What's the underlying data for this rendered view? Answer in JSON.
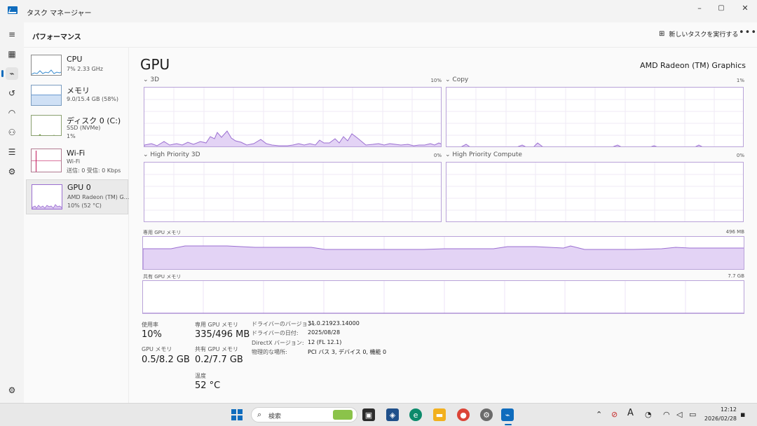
{
  "window": {
    "title": "タスク マネージャー",
    "controls": {
      "minimize": "–",
      "maximize": "▢",
      "close": "✕"
    }
  },
  "header": {
    "title": "パフォーマンス",
    "new_task_label": "新しいタスクを実行する",
    "more_label": "•••"
  },
  "rail": {
    "icons": [
      "menu-icon",
      "processes-icon",
      "performance-icon",
      "app-history-icon",
      "startup-icon",
      "users-icon",
      "details-icon",
      "services-icon",
      "settings-icon"
    ]
  },
  "sidebar": {
    "items": [
      {
        "name": "CPU",
        "sub1": "7% 2.33 GHz",
        "sub2": ""
      },
      {
        "name": "メモリ",
        "sub1": "9.0/15.4 GB (58%)",
        "sub2": ""
      },
      {
        "name": "ディスク 0 (C:)",
        "sub1": "SSD (NVMe)",
        "sub2": "1%"
      },
      {
        "name": "Wi-Fi",
        "sub1": "Wi-Fi",
        "sub2": "送信: 0 受信: 0 Kbps"
      },
      {
        "name": "GPU 0",
        "sub1": "AMD Radeon (TM) G...",
        "sub2": "10% (52 °C)"
      }
    ]
  },
  "main": {
    "title": "GPU",
    "model": "AMD Radeon (TM) Graphics",
    "engines": [
      {
        "label": "3D",
        "pct": "10%"
      },
      {
        "label": "Copy",
        "pct": "1%"
      },
      {
        "label": "High Priority 3D",
        "pct": "0%"
      },
      {
        "label": "High Priority Compute",
        "pct": "0%"
      }
    ],
    "dedicated_mem": {
      "label": "専用 GPU メモリ",
      "max": "496 MB"
    },
    "shared_mem": {
      "label": "共有 GPU メモリ",
      "max": "7.7 GB"
    },
    "stats": {
      "util_label": "使用率",
      "util_value": "10%",
      "gpumem_label": "GPU メモリ",
      "gpumem_value": "0.5/8.2 GB",
      "dedicated_label": "専用 GPU メモリ",
      "dedicated_value": "335/496 MB",
      "shared_label": "共有 GPU メモリ",
      "shared_value": "0.2/7.7 GB",
      "temp_label": "温度",
      "temp_value": "52 °C"
    },
    "info": [
      {
        "key": "ドライバーのバージョン:",
        "value": "31.0.21923.14000"
      },
      {
        "key": "ドライバーの日付:",
        "value": "2025/08/28"
      },
      {
        "key": "DirectX バージョン:",
        "value": "12 (FL 12.1)"
      },
      {
        "key": "物理的な場所:",
        "value": "PCI バス 3, デバイス 0, 機能 0"
      }
    ]
  },
  "taskbar": {
    "search_placeholder": "検索",
    "time": "12:12",
    "date": "2026/02/28",
    "ime": "A",
    "colors": {
      "accent": "#0f6cbd",
      "graph_line": "#9b6fd1",
      "graph_fill": "#e3d3f5"
    }
  }
}
